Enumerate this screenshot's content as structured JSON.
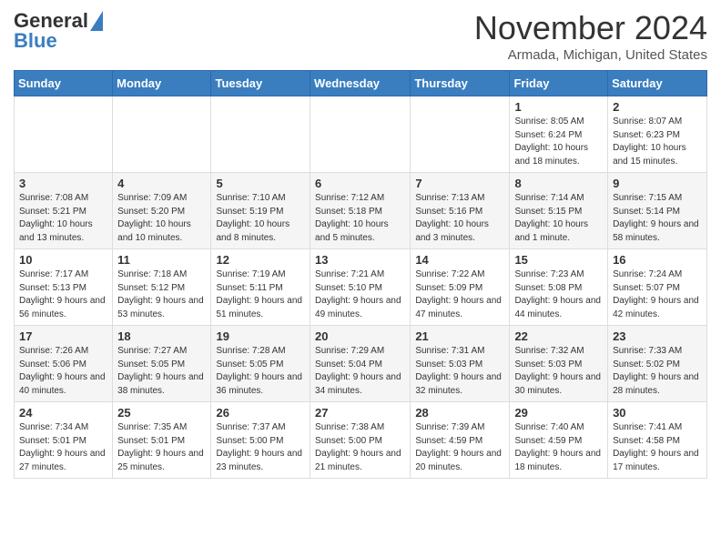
{
  "header": {
    "logo_line1": "General",
    "logo_line2": "Blue",
    "month": "November 2024",
    "location": "Armada, Michigan, United States"
  },
  "days_of_week": [
    "Sunday",
    "Monday",
    "Tuesday",
    "Wednesday",
    "Thursday",
    "Friday",
    "Saturday"
  ],
  "weeks": [
    [
      {
        "day": "",
        "info": ""
      },
      {
        "day": "",
        "info": ""
      },
      {
        "day": "",
        "info": ""
      },
      {
        "day": "",
        "info": ""
      },
      {
        "day": "",
        "info": ""
      },
      {
        "day": "1",
        "info": "Sunrise: 8:05 AM\nSunset: 6:24 PM\nDaylight: 10 hours and 18 minutes."
      },
      {
        "day": "2",
        "info": "Sunrise: 8:07 AM\nSunset: 6:23 PM\nDaylight: 10 hours and 15 minutes."
      }
    ],
    [
      {
        "day": "3",
        "info": "Sunrise: 7:08 AM\nSunset: 5:21 PM\nDaylight: 10 hours and 13 minutes."
      },
      {
        "day": "4",
        "info": "Sunrise: 7:09 AM\nSunset: 5:20 PM\nDaylight: 10 hours and 10 minutes."
      },
      {
        "day": "5",
        "info": "Sunrise: 7:10 AM\nSunset: 5:19 PM\nDaylight: 10 hours and 8 minutes."
      },
      {
        "day": "6",
        "info": "Sunrise: 7:12 AM\nSunset: 5:18 PM\nDaylight: 10 hours and 5 minutes."
      },
      {
        "day": "7",
        "info": "Sunrise: 7:13 AM\nSunset: 5:16 PM\nDaylight: 10 hours and 3 minutes."
      },
      {
        "day": "8",
        "info": "Sunrise: 7:14 AM\nSunset: 5:15 PM\nDaylight: 10 hours and 1 minute."
      },
      {
        "day": "9",
        "info": "Sunrise: 7:15 AM\nSunset: 5:14 PM\nDaylight: 9 hours and 58 minutes."
      }
    ],
    [
      {
        "day": "10",
        "info": "Sunrise: 7:17 AM\nSunset: 5:13 PM\nDaylight: 9 hours and 56 minutes."
      },
      {
        "day": "11",
        "info": "Sunrise: 7:18 AM\nSunset: 5:12 PM\nDaylight: 9 hours and 53 minutes."
      },
      {
        "day": "12",
        "info": "Sunrise: 7:19 AM\nSunset: 5:11 PM\nDaylight: 9 hours and 51 minutes."
      },
      {
        "day": "13",
        "info": "Sunrise: 7:21 AM\nSunset: 5:10 PM\nDaylight: 9 hours and 49 minutes."
      },
      {
        "day": "14",
        "info": "Sunrise: 7:22 AM\nSunset: 5:09 PM\nDaylight: 9 hours and 47 minutes."
      },
      {
        "day": "15",
        "info": "Sunrise: 7:23 AM\nSunset: 5:08 PM\nDaylight: 9 hours and 44 minutes."
      },
      {
        "day": "16",
        "info": "Sunrise: 7:24 AM\nSunset: 5:07 PM\nDaylight: 9 hours and 42 minutes."
      }
    ],
    [
      {
        "day": "17",
        "info": "Sunrise: 7:26 AM\nSunset: 5:06 PM\nDaylight: 9 hours and 40 minutes."
      },
      {
        "day": "18",
        "info": "Sunrise: 7:27 AM\nSunset: 5:05 PM\nDaylight: 9 hours and 38 minutes."
      },
      {
        "day": "19",
        "info": "Sunrise: 7:28 AM\nSunset: 5:05 PM\nDaylight: 9 hours and 36 minutes."
      },
      {
        "day": "20",
        "info": "Sunrise: 7:29 AM\nSunset: 5:04 PM\nDaylight: 9 hours and 34 minutes."
      },
      {
        "day": "21",
        "info": "Sunrise: 7:31 AM\nSunset: 5:03 PM\nDaylight: 9 hours and 32 minutes."
      },
      {
        "day": "22",
        "info": "Sunrise: 7:32 AM\nSunset: 5:03 PM\nDaylight: 9 hours and 30 minutes."
      },
      {
        "day": "23",
        "info": "Sunrise: 7:33 AM\nSunset: 5:02 PM\nDaylight: 9 hours and 28 minutes."
      }
    ],
    [
      {
        "day": "24",
        "info": "Sunrise: 7:34 AM\nSunset: 5:01 PM\nDaylight: 9 hours and 27 minutes."
      },
      {
        "day": "25",
        "info": "Sunrise: 7:35 AM\nSunset: 5:01 PM\nDaylight: 9 hours and 25 minutes."
      },
      {
        "day": "26",
        "info": "Sunrise: 7:37 AM\nSunset: 5:00 PM\nDaylight: 9 hours and 23 minutes."
      },
      {
        "day": "27",
        "info": "Sunrise: 7:38 AM\nSunset: 5:00 PM\nDaylight: 9 hours and 21 minutes."
      },
      {
        "day": "28",
        "info": "Sunrise: 7:39 AM\nSunset: 4:59 PM\nDaylight: 9 hours and 20 minutes."
      },
      {
        "day": "29",
        "info": "Sunrise: 7:40 AM\nSunset: 4:59 PM\nDaylight: 9 hours and 18 minutes."
      },
      {
        "day": "30",
        "info": "Sunrise: 7:41 AM\nSunset: 4:58 PM\nDaylight: 9 hours and 17 minutes."
      }
    ]
  ]
}
